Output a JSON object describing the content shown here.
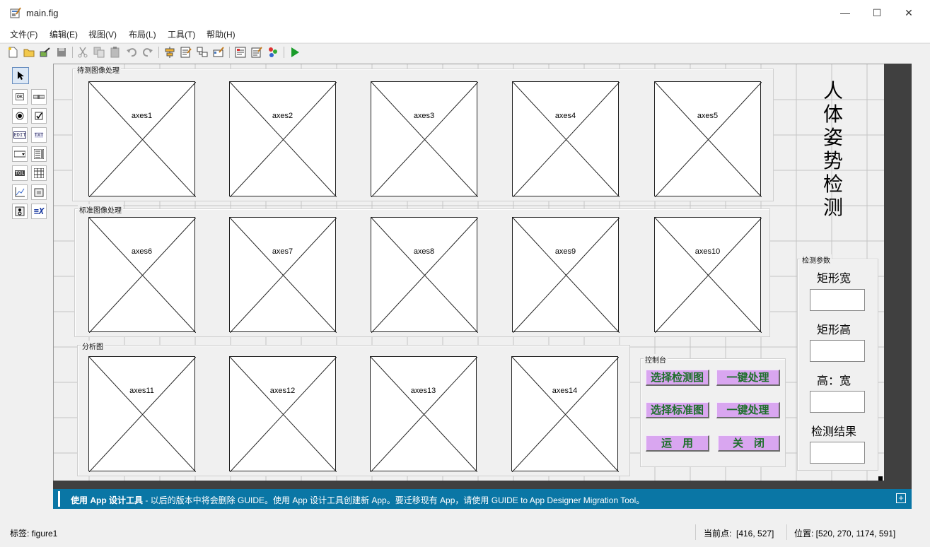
{
  "window": {
    "title": "main.fig",
    "minimize": "—",
    "maximize": "☐",
    "close": "✕"
  },
  "menu": [
    "文件(F)",
    "编辑(E)",
    "视图(V)",
    "布局(L)",
    "工具(T)",
    "帮助(H)"
  ],
  "panels": {
    "p1": "待测图像处理",
    "p2": "标准图像处理",
    "p3": "分析图",
    "control": "控制台",
    "params": "检测参数"
  },
  "axes": [
    "axes1",
    "axes2",
    "axes3",
    "axes4",
    "axes5",
    "axes6",
    "axes7",
    "axes8",
    "axes9",
    "axes10",
    "axes11",
    "axes12",
    "axes13",
    "axes14"
  ],
  "buttons": {
    "select_detect": "选择检测图",
    "one_key_1": "一键处理",
    "select_standard": "选择标准图",
    "one_key_2": "一键处理",
    "apply": "运　用",
    "close": "关　闭"
  },
  "title_text": "人体姿势检测",
  "params": {
    "rect_width": "矩形宽",
    "rect_height": "矩形高",
    "ratio": "高：宽",
    "result": "检测结果"
  },
  "banner": {
    "bold": "使用 App 设计工具",
    "text": " - 以后的版本中将会删除 GUIDE。使用 App 设计工具创建新 App。要迁移现有 App，请使用 GUIDE to App Designer Migration Tool。",
    "expand": "+"
  },
  "status": {
    "tag": "标签: figure1",
    "current_point": "当前点:  [416, 527]",
    "position": "位置: [520, 270, 1174, 591]"
  },
  "colors": {
    "button_bg": "#d9a6f0",
    "button_text": "#1d6f2a",
    "banner_bg": "#0a76a5"
  }
}
